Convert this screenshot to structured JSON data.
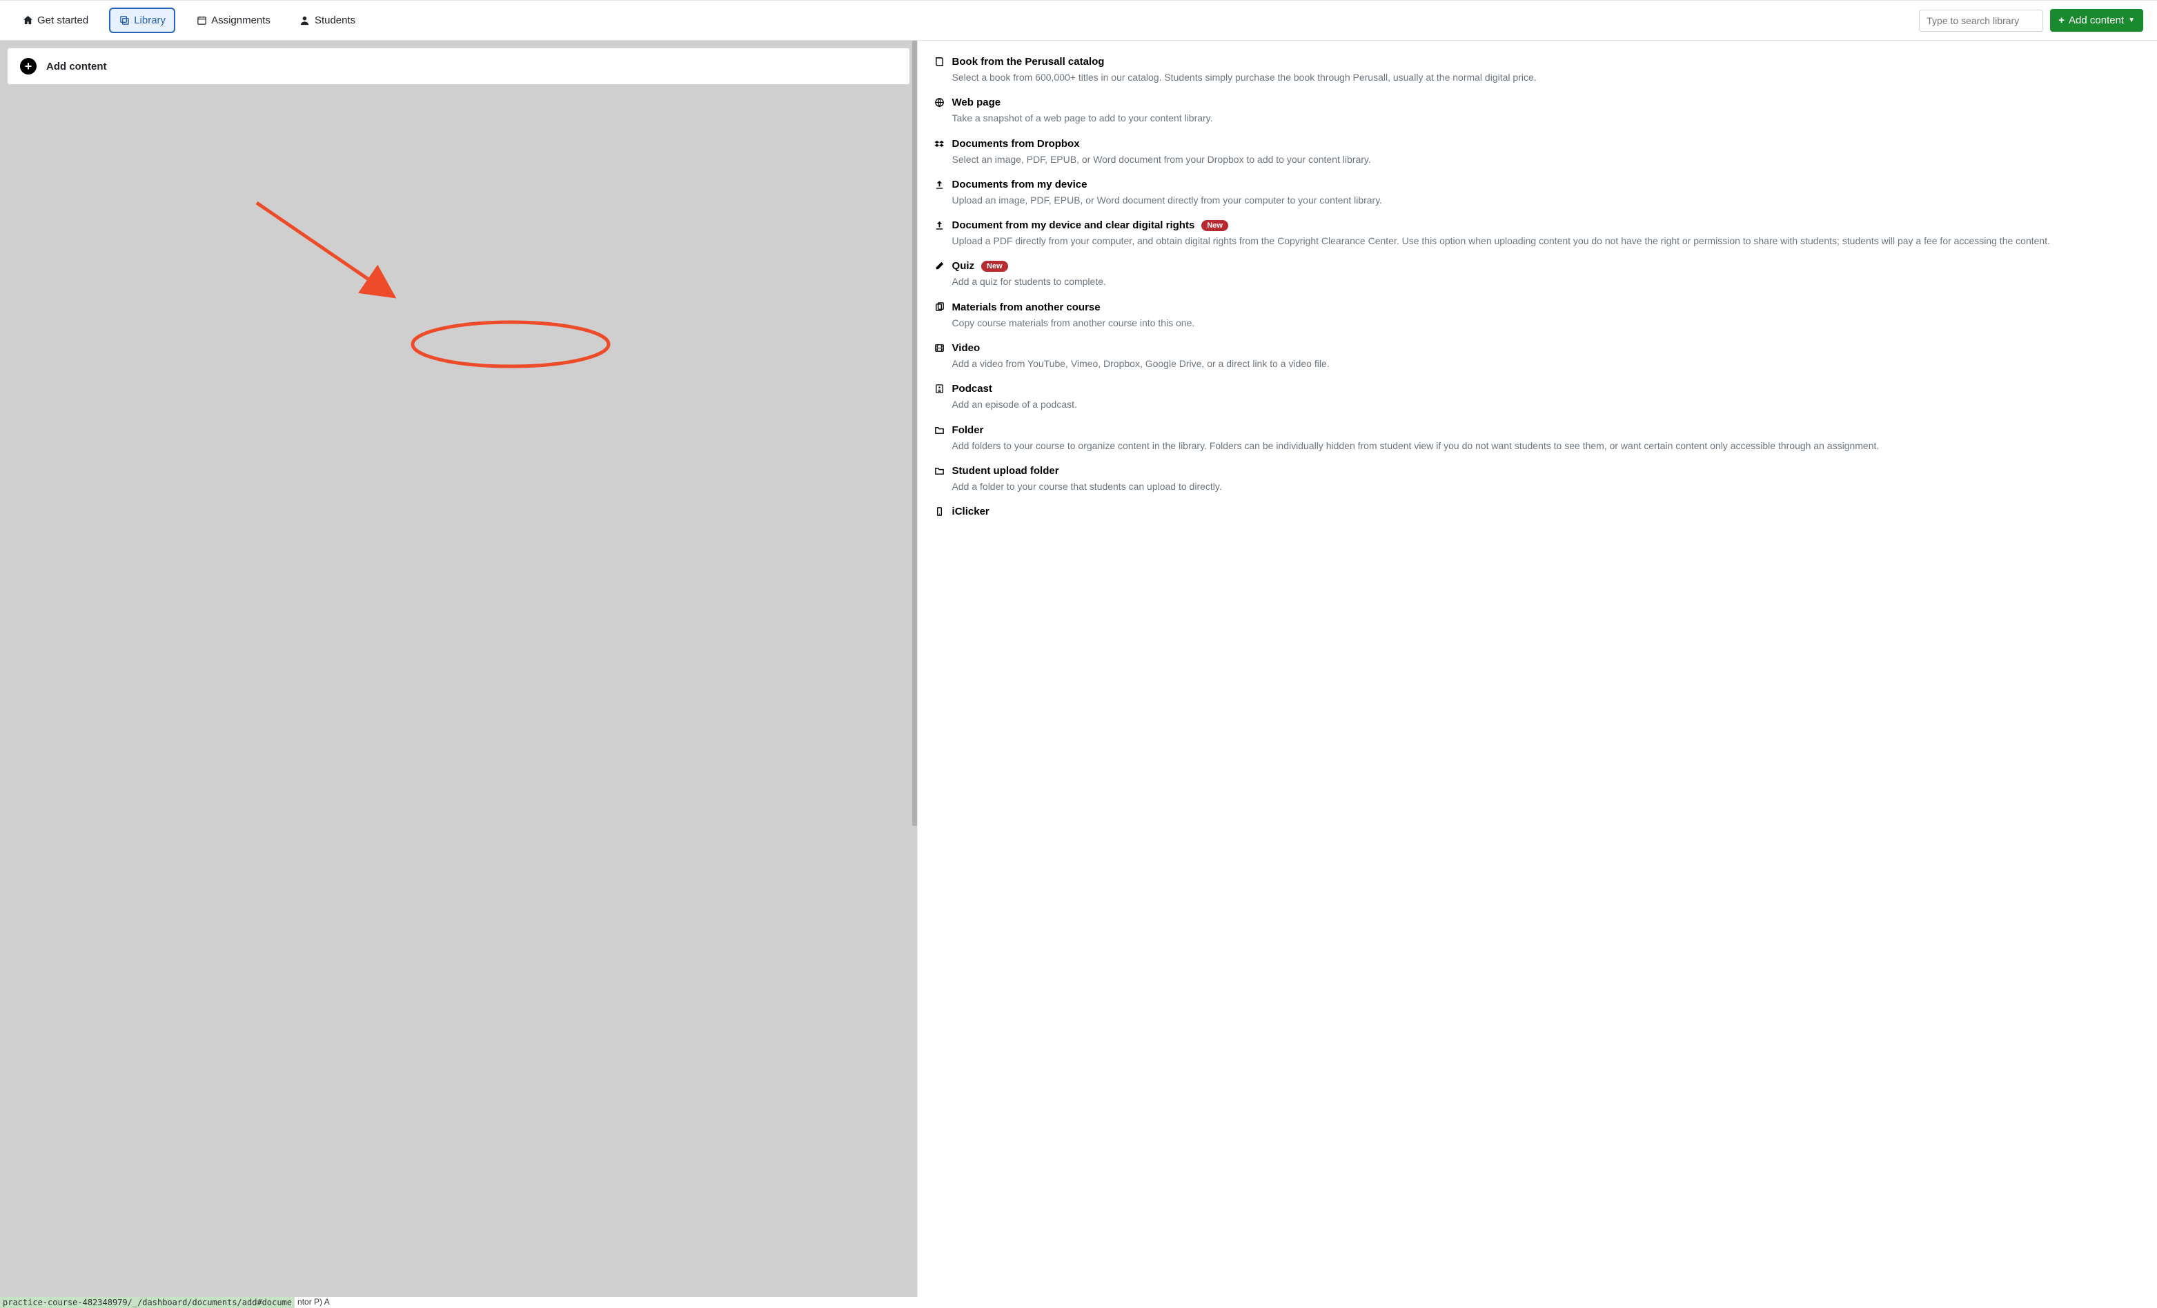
{
  "nav": {
    "get_started": "Get started",
    "library": "Library",
    "assignments": "Assignments",
    "students": "Students"
  },
  "search": {
    "placeholder": "Type to search library"
  },
  "buttons": {
    "add_content_top": "Add content",
    "add_content_left": "Add content"
  },
  "options": [
    {
      "icon": "book",
      "title": "Book from the Perusall catalog",
      "desc": "Select a book from 600,000+ titles in our catalog. Students simply purchase the book through Perusall, usually at the normal digital price."
    },
    {
      "icon": "globe",
      "title": "Web page",
      "desc": "Take a snapshot of a web page to add to your content library."
    },
    {
      "icon": "dropbox",
      "title": "Documents from Dropbox",
      "desc": "Select an image, PDF, EPUB, or Word document from your Dropbox to add to your content library."
    },
    {
      "icon": "upload",
      "title": "Documents from my device",
      "desc": "Upload an image, PDF, EPUB, or Word document directly from your computer to your content library."
    },
    {
      "icon": "upload",
      "title": "Document from my device and clear digital rights",
      "badge": "New",
      "desc": "Upload a PDF directly from your computer, and obtain digital rights from the Copyright Clearance Center. Use this option when uploading content you do not have the right or permission to share with students; students will pay a fee for accessing the content."
    },
    {
      "icon": "pencil",
      "title": "Quiz",
      "badge": "New",
      "desc": "Add a quiz for students to complete."
    },
    {
      "icon": "copy",
      "title": "Materials from another course",
      "desc": "Copy course materials from another course into this one."
    },
    {
      "icon": "film",
      "title": "Video",
      "desc": "Add a video from YouTube, Vimeo, Dropbox, Google Drive, or a direct link to a video file."
    },
    {
      "icon": "podcast",
      "title": "Podcast",
      "desc": "Add an episode of a podcast."
    },
    {
      "icon": "folder",
      "title": "Folder",
      "desc": "Add folders to your course to organize content in the library. Folders can be individually hidden from student view if you do not want students to see them, or want certain content only accessible through an assignment."
    },
    {
      "icon": "folder",
      "title": "Student upload folder",
      "desc": "Add a folder to your course that students can upload to directly."
    },
    {
      "icon": "mobile",
      "title": "iClicker",
      "desc": ""
    }
  ],
  "status": {
    "url": "practice-course-482348979/_/dashboard/documents/add#docume",
    "suffix": "ntor P) A"
  }
}
